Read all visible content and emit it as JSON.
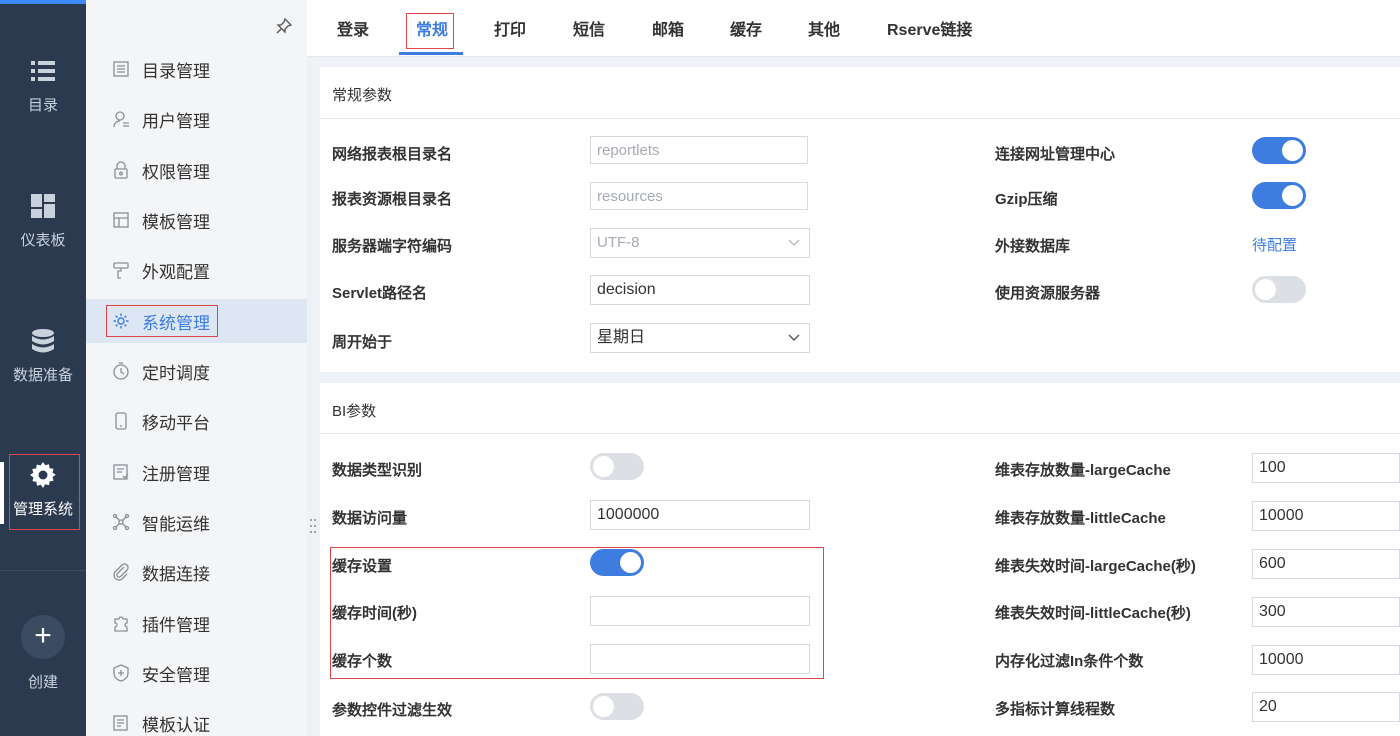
{
  "rail": {
    "items": [
      {
        "label": "目录",
        "icon": "list-icon"
      },
      {
        "label": "仪表板",
        "icon": "dashboard-icon"
      },
      {
        "label": "数据准备",
        "icon": "database-icon"
      },
      {
        "label": "管理系统",
        "icon": "gear-icon"
      }
    ],
    "create_label": "创建",
    "create_symbol": "+"
  },
  "submenu": {
    "items": [
      {
        "label": "目录管理",
        "icon": "catalog-icon"
      },
      {
        "label": "用户管理",
        "icon": "user-icon"
      },
      {
        "label": "权限管理",
        "icon": "lock-icon"
      },
      {
        "label": "模板管理",
        "icon": "template-icon"
      },
      {
        "label": "外观配置",
        "icon": "brush-icon"
      },
      {
        "label": "系统管理",
        "icon": "gear-icon"
      },
      {
        "label": "定时调度",
        "icon": "timer-icon"
      },
      {
        "label": "移动平台",
        "icon": "mobile-icon"
      },
      {
        "label": "注册管理",
        "icon": "register-icon"
      },
      {
        "label": "智能运维",
        "icon": "network-icon"
      },
      {
        "label": "数据连接",
        "icon": "link-icon"
      },
      {
        "label": "插件管理",
        "icon": "puzzle-icon"
      },
      {
        "label": "安全管理",
        "icon": "shield-icon"
      },
      {
        "label": "模板认证",
        "icon": "certificate-icon"
      }
    ],
    "active": "系统管理"
  },
  "tabs": [
    "登录",
    "常规",
    "打印",
    "短信",
    "邮箱",
    "缓存",
    "其他",
    "Rserve链接"
  ],
  "active_tab": "常规",
  "general": {
    "title": "常规参数",
    "report_root_label": "网络报表根目录名",
    "report_root_placeholder": "reportlets",
    "resource_root_label": "报表资源根目录名",
    "resource_root_placeholder": "resources",
    "charset_label": "服务器端字符编码",
    "charset_value": "UTF-8",
    "servlet_label": "Servlet路径名",
    "servlet_value": "decision",
    "week_start_label": "周开始于",
    "week_start_value": "星期日",
    "url_center_label": "连接网址管理中心",
    "url_center_on": true,
    "gzip_label": "Gzip压缩",
    "gzip_on": true,
    "external_db_label": "外接数据库",
    "external_db_link": "待配置",
    "resource_server_label": "使用资源服务器",
    "resource_server_on": false
  },
  "bi": {
    "title": "BI参数",
    "type_detect_label": "数据类型识别",
    "type_detect_on": false,
    "access_amount_label": "数据访问量",
    "access_amount_value": "1000000",
    "cache_setting_label": "缓存设置",
    "cache_setting_on": true,
    "cache_time_label": "缓存时间(秒)",
    "cache_time_value": "",
    "cache_count_label": "缓存个数",
    "cache_count_value": "",
    "param_filter_label": "参数控件过滤生效",
    "param_filter_on": false,
    "large_cache_label": "维表存放数量-largeCache",
    "large_cache_value": "100",
    "little_cache_label": "维表存放数量-littleCache",
    "little_cache_value": "10000",
    "large_expire_label": "维表失效时间-largeCache(秒)",
    "large_expire_value": "600",
    "little_expire_label": "维表失效时间-littleCache(秒)",
    "little_expire_value": "300",
    "in_filter_label": "内存化过滤In条件个数",
    "in_filter_value": "10000",
    "threads_label": "多指标计算线程数",
    "threads_value": "20"
  },
  "colors": {
    "accent": "#3d7de0",
    "rail_bg": "#2b3a4f",
    "highlight": "#e0454b"
  }
}
